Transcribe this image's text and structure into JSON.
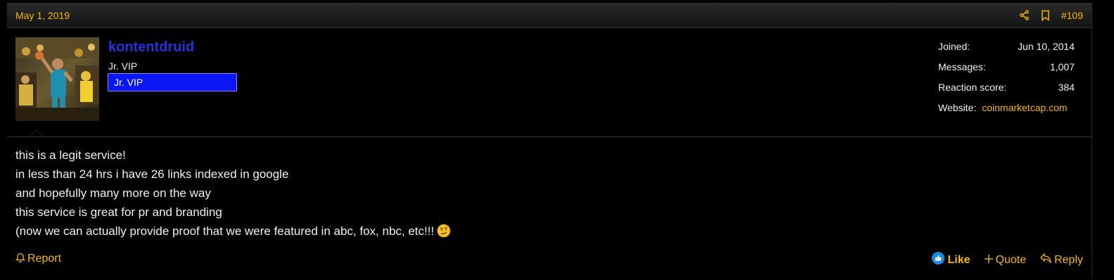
{
  "post": {
    "date": "May 1, 2019",
    "number": "#109",
    "author": {
      "username": "kontentdruid",
      "title": "Jr. VIP",
      "banner": "Jr. VIP"
    },
    "stats": {
      "joined_label": "Joined:",
      "joined_value": "Jun 10, 2014",
      "messages_label": "Messages:",
      "messages_value": "1,007",
      "reaction_label": "Reaction score:",
      "reaction_value": "384",
      "website_label": "Website:",
      "website_value": "coinmarketcap.com"
    },
    "message_lines": [
      "this is a legit service!",
      "in less than 24 hrs i have 26 links indexed in google",
      "and hopefully many more on the way",
      "this service is great for pr and branding",
      "(now we can actually provide proof that we were featured in abc, fox, nbc, etc!!!"
    ],
    "actions": {
      "report": "Report",
      "like": "Like",
      "quote": "Quote",
      "reply": "Reply"
    }
  },
  "colors": {
    "accent": "#f5b800",
    "username": "#2233dd",
    "banner": "#0b17f2",
    "background": "#000000"
  },
  "icons": [
    "share-icon",
    "bookmark-icon",
    "bell-icon",
    "like-icon",
    "plus-icon",
    "reply-icon",
    "smirk-emoji-icon"
  ]
}
